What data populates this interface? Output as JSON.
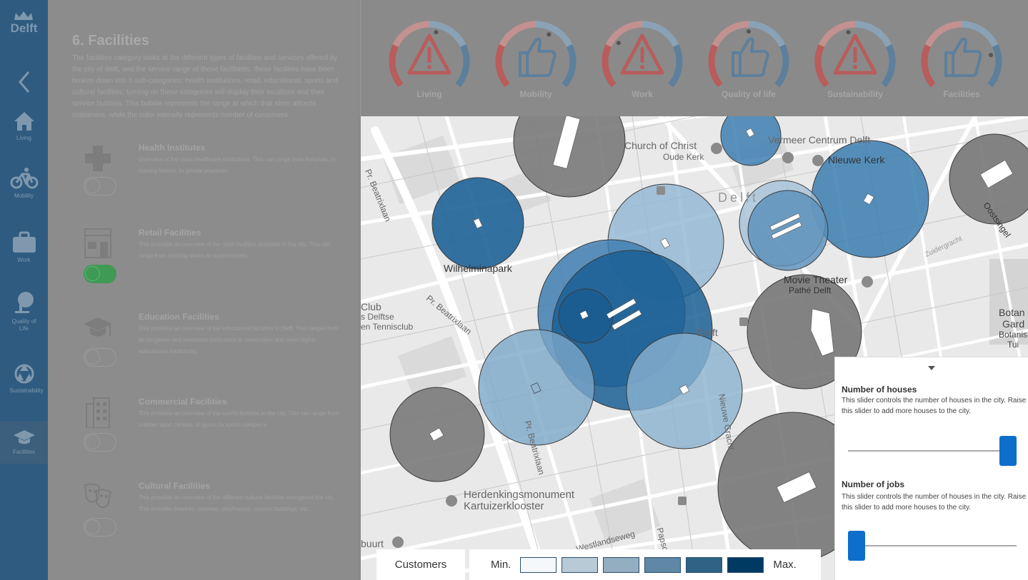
{
  "nav": {
    "logo_text": "Delft",
    "items": [
      {
        "label": "Living",
        "icon": "home-icon"
      },
      {
        "label": "Mobility",
        "icon": "bicycle-icon"
      },
      {
        "label": "Work",
        "icon": "briefcase-icon"
      },
      {
        "label": "Quality of Life",
        "icon": "tree-icon"
      },
      {
        "label": "Sustainability",
        "icon": "recycle-icon"
      },
      {
        "label": "Facilities",
        "icon": "graduation-cap-icon"
      }
    ],
    "active": "Facilities"
  },
  "panel": {
    "title": "6. Facilities",
    "intro": "The facilities category looks at the different types of facilities and services offered by the city of delft, and the service range of these facilitates. these facilities have been broken down into 5 sub-categories: health institutions, retail, educational, sports and cultural facilities. turning on these categories will display their locations and their service bubbles. This bubble represents the range at which that store attracts customers, while the color intensity represents number of customers.",
    "facilities": [
      {
        "name": "Health Institutes",
        "desc": "Overview of the cities healthcare institutions. This can range from hospitals, to nursing homes, to private practices.",
        "icon": "medical-cross-icon",
        "on": false
      },
      {
        "name": "Retail Facilities",
        "desc": "This provides an overview of the retail facilities available in the city. This can range from clothing stores to supermarkets.",
        "icon": "storefront-icon",
        "on": true
      },
      {
        "name": "Education Facilities",
        "desc": "This provides an overview of the educational facilities in Delft. This ranges from kindergarten and preschool institutions to universities and other higher educational institutions.",
        "icon": "graduation-cap-icon",
        "on": false
      },
      {
        "name": "Commercial Facilities",
        "desc": "This provides an overview of the sports facilities in the city. This can range from outdoor sport centres, to gyms, to sports compex's",
        "icon": "office-building-icon",
        "on": false
      },
      {
        "name": "Cultural Facilities",
        "desc": "This provides an overview of the different cultural facilities throughout the city. This includes theatres, cinemas, playhouses, concert buildings, etc....",
        "icon": "theatre-masks-icon",
        "on": false
      }
    ]
  },
  "gauges": [
    {
      "label": "Living",
      "icon": "warning-icon",
      "needle": 0.55
    },
    {
      "label": "Mobility",
      "icon": "thumbs-up-icon",
      "needle": 0.6
    },
    {
      "label": "Work",
      "icon": "warning-icon",
      "needle": 0.3
    },
    {
      "label": "Quality of life",
      "icon": "thumbs-up-icon",
      "needle": 0.5
    },
    {
      "label": "Sustainability",
      "icon": "warning-icon",
      "needle": 0.45
    },
    {
      "label": "Facilities",
      "icon": "thumbs-up-icon",
      "needle": 0.8
    }
  ],
  "map": {
    "labels": [
      "Church of Christ",
      "Oude Kerk",
      "Vermeer Centrum Delft",
      "Nieuwe Kerk",
      "Delft",
      "Wilhelminapark",
      "Pr. Beatrixlaan",
      "Pr. Beatrixlaan",
      "Pr. Beatrixlaan",
      "Movie Theater",
      "Pathé Delft",
      "Club",
      "s Delftse",
      "en Tennisclub",
      "Delft",
      "Nieuwe Gracht",
      "Herdenkingsmonument",
      "Kartuizerklooster",
      "Westlandseweg",
      "buurt",
      "Zuidergracht",
      "Oostsingel",
      "Botan",
      "Gard",
      "Botanis",
      "Tui",
      "Papsc"
    ]
  },
  "legend": {
    "title": "Customers",
    "min": "Min.",
    "max": "Max.",
    "colors": [
      "#f4f8fb",
      "#b9cad7",
      "#93adc1",
      "#5f87a6",
      "#2f6285",
      "#003a63"
    ]
  },
  "sliders": [
    {
      "title": "Number of houses",
      "desc": "This slider controls the number of houses in the city. Raise this slider to add more houses to the city.",
      "value": 1.0
    },
    {
      "title": "Number of jobs",
      "desc": "This slider controls the number of houses in the city. Raise this slider to add more houses to the city.",
      "value": 0.0
    }
  ],
  "colors": {
    "nav": "#2f5b80",
    "bubble_light": "#a8c6dc",
    "bubble_mid": "#5a92bd",
    "bubble_dark": "#1e6397",
    "bubble_gray": "#6f6f6f",
    "toggle_on": "#3e9a54",
    "slider": "#0d6ecc"
  }
}
